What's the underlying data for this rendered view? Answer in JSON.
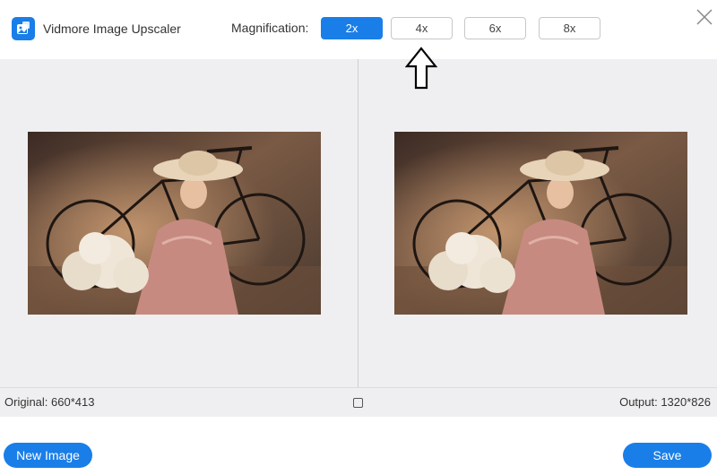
{
  "app": {
    "title": "Vidmore Image Upscaler",
    "accent_color": "#1a7ee8"
  },
  "magnification": {
    "label": "Magnification:",
    "options": [
      {
        "label": "2x",
        "selected": true
      },
      {
        "label": "4x",
        "selected": false
      },
      {
        "label": "6x",
        "selected": false
      },
      {
        "label": "8x",
        "selected": false
      }
    ]
  },
  "icons": {
    "close": "close-icon",
    "pointer": "up-arrow-icon",
    "compare": "compare-square-icon",
    "logo": "image-upscaler-logo-icon"
  },
  "preview": {
    "original_image": "woman-in-hat-with-flowers-and-bicycle",
    "output_image": "woman-in-hat-with-flowers-and-bicycle"
  },
  "info": {
    "original": "Original: 660*413",
    "output": "Output: 1320*826"
  },
  "footer": {
    "new_image_label": "New Image",
    "save_label": "Save"
  }
}
